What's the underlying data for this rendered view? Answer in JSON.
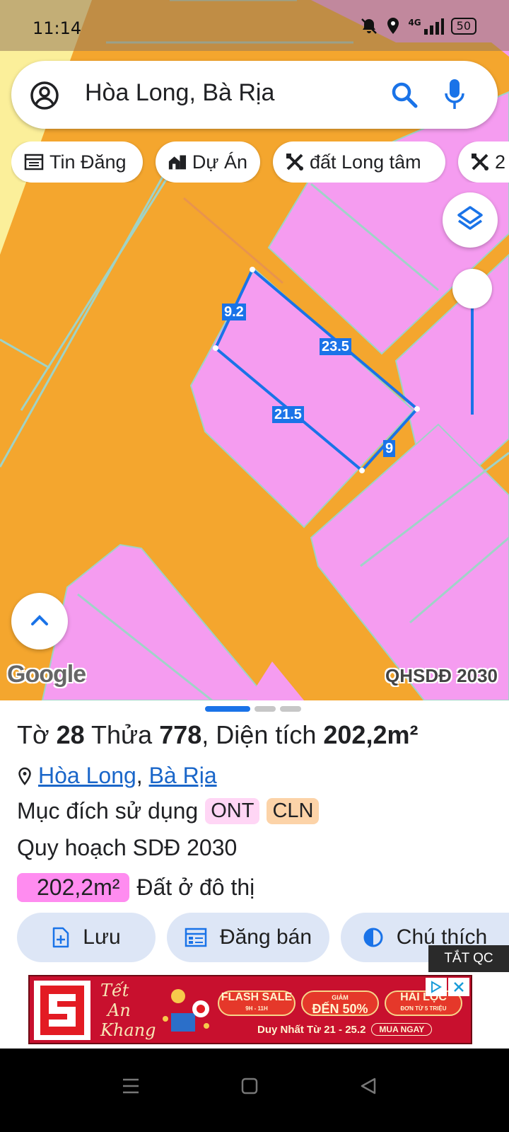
{
  "status_bar": {
    "time": "11:14",
    "network": "4G",
    "battery": "50"
  },
  "search": {
    "query": "Hòa Long, Bà Rịa"
  },
  "chips": [
    {
      "label": "Tin Đăng",
      "icon": "news-icon"
    },
    {
      "label": "Dự Án",
      "icon": "buildings-icon"
    },
    {
      "label": "đất Long tâm",
      "icon": "tools-icon"
    },
    {
      "label": "2",
      "icon": "tools-icon"
    }
  ],
  "map": {
    "dimensions": [
      "9.2",
      "23.5",
      "21.5",
      "9"
    ],
    "attribution": "Google",
    "layer_label": "QHSDĐ 2030",
    "colors": {
      "road": "#f4a62e",
      "residential": "#f59cf0",
      "parcel_outline": "#1a73e8"
    }
  },
  "sheet": {
    "title": {
      "sheet_label": "Tờ",
      "sheet_no": "28",
      "parcel_label": "Thửa",
      "parcel_no": "778",
      "area_label": "Diện tích",
      "area_value": "202,2m²"
    },
    "location": {
      "ward": "Hòa Long",
      "separator": ",",
      "city": "Bà Rịa"
    },
    "purpose": {
      "label": "Mục đích sử dụng",
      "tags": [
        "ONT",
        "CLN"
      ]
    },
    "plan_label": "Quy hoạch SDĐ 2030",
    "plan_area": {
      "value": "202,2m²",
      "description": "Đất ở đô thị"
    },
    "actions": {
      "save": "Lưu",
      "post": "Đăng bán",
      "legend": "Chú thích"
    }
  },
  "ad": {
    "close_label": "TẮT QC",
    "brand": [
      "Tết",
      "An",
      "Khang"
    ],
    "pills": [
      {
        "top": "FLASH SALE",
        "bottom": "9H - 11H"
      },
      {
        "top": "GIẢM",
        "bottom": "ĐẾN 50%"
      },
      {
        "top": "HÁI LỘC",
        "bottom": "ĐƠN TỪ 5 TRIỆU"
      }
    ],
    "footer": "Duy Nhất Từ 21 - 25.2",
    "cta": "MUA NGAY"
  }
}
